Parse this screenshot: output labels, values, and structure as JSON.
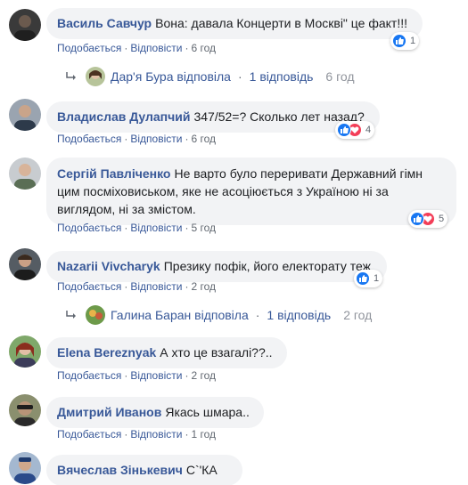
{
  "labels": {
    "like": "Подобається",
    "reply": "Відповісти",
    "separator": "·"
  },
  "colors": {
    "link": "#385898",
    "bubble": "#f2f3f5",
    "like": "#1877f2",
    "love": "#f33e58"
  },
  "comments": [
    {
      "author": "Василь Савчур",
      "text": "Вона: давала Концерти в Москві\" це факт!!!",
      "time": "6 год",
      "reaction_count": "1",
      "reactions": [
        "like-icon"
      ],
      "reply": {
        "name": "Дар'я Бура відповіла",
        "count": "1 відповідь",
        "time": "6 год"
      }
    },
    {
      "author": "Владислав Дулапчий",
      "text": "347/52=? Сколько лет назад?",
      "time": "6 год",
      "reaction_count": "4",
      "reactions": [
        "like-icon",
        "love-icon"
      ]
    },
    {
      "author": "Сергій Павліченко",
      "text_lines": [
        "Не варто було переривати Державний гімн",
        "цим посміховиськом, яке не асоціюється з Україною ні за",
        "виглядом, ні за змістом."
      ],
      "time": "5 год",
      "reaction_count": "5",
      "reactions": [
        "like-icon",
        "love-icon"
      ]
    },
    {
      "author": "Nazarii Vivcharyk",
      "text": "Презику пофік, його електорату теж",
      "time": "2 год",
      "reaction_count": "1",
      "reactions": [
        "like-icon"
      ],
      "reply": {
        "name": "Галина Баран відповіла",
        "count": "1 відповідь",
        "time": "2 год"
      }
    },
    {
      "author": "Elena Bereznyak",
      "text": "А хто це взагалі??..",
      "time": "2 год"
    },
    {
      "author": "Дмитрий Иванов",
      "text": "Якась шмара..",
      "time": "1 год"
    },
    {
      "author": "Вячеслав Зінькевич",
      "text": "С`'КА"
    }
  ]
}
